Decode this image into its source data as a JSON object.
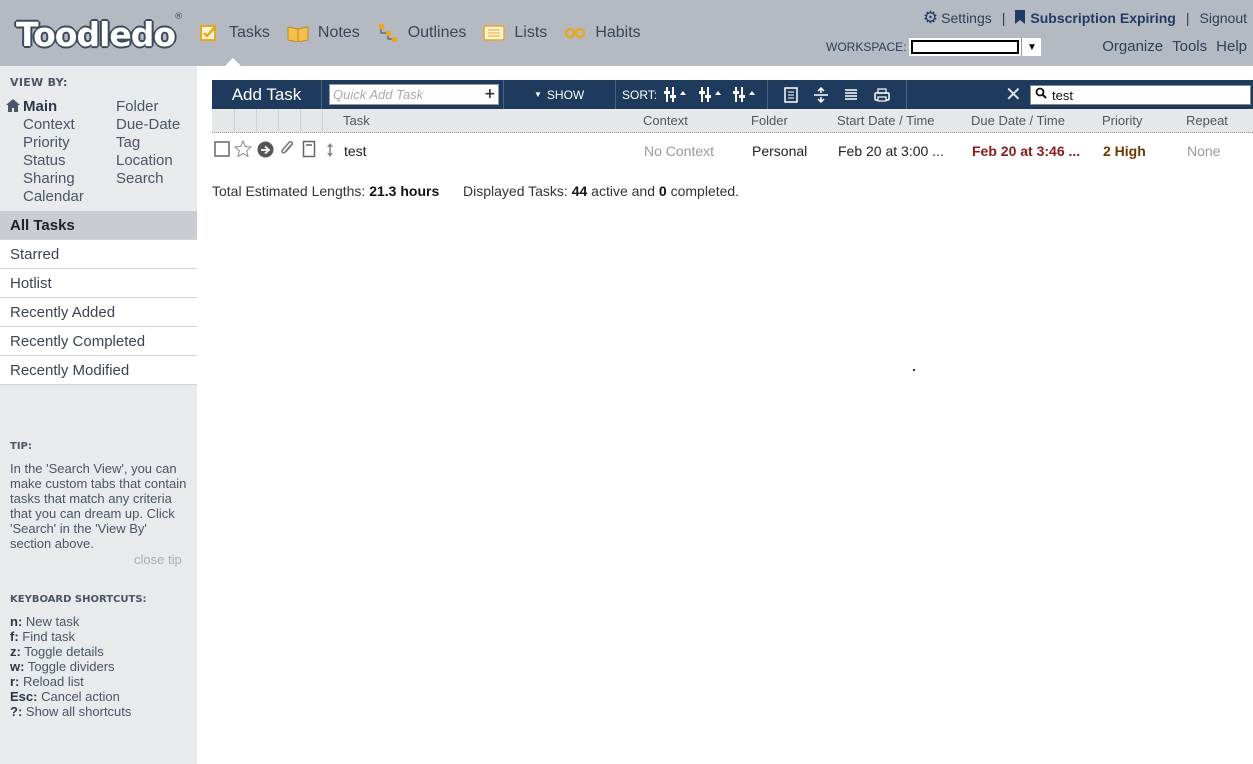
{
  "app": {
    "logo_text": "Toodledo",
    "logo_reg": "®"
  },
  "nav": {
    "items": [
      {
        "label": "Tasks",
        "icon": "tasks-icon"
      },
      {
        "label": "Notes",
        "icon": "notes-icon"
      },
      {
        "label": "Outlines",
        "icon": "outlines-icon"
      },
      {
        "label": "Lists",
        "icon": "lists-icon"
      },
      {
        "label": "Habits",
        "icon": "habits-icon"
      }
    ]
  },
  "topbar": {
    "settings": "Settings",
    "separator": "|",
    "subscription": "Subscription Expiring",
    "signout": "Signout",
    "workspace_label": "WORKSPACE:",
    "workspace_arrow": "▼",
    "organize": "Organize",
    "tools": "Tools",
    "help": "Help"
  },
  "sidebar": {
    "viewby_title": "VIEW BY:",
    "viewby_left": [
      "Main",
      "Context",
      "Priority",
      "Status",
      "Sharing",
      "Calendar"
    ],
    "viewby_right": [
      "Folder",
      "Due-Date",
      "Tag",
      "Location",
      "Search"
    ],
    "lists": [
      "All Tasks",
      "Starred",
      "Hotlist",
      "Recently Added",
      "Recently Completed",
      "Recently Modified"
    ],
    "tip_title": "TIP:",
    "tip_text": "In the 'Search View', you can make custom tabs that contain tasks that match any criteria that you can dream up. Click 'Search' in the 'View By' section above.",
    "close_tip": "close tip",
    "shortcuts_title": "KEYBOARD SHORTCUTS:",
    "shortcuts": [
      {
        "key": "n:",
        "desc": "New task"
      },
      {
        "key": "f:",
        "desc": "Find task"
      },
      {
        "key": "z:",
        "desc": "Toggle details"
      },
      {
        "key": "w:",
        "desc": "Toggle dividers"
      },
      {
        "key": "r:",
        "desc": "Reload list"
      },
      {
        "key": "Esc:",
        "desc": "Cancel action"
      },
      {
        "key": "?:",
        "desc": "Show all shortcuts"
      }
    ]
  },
  "toolbar": {
    "add_task": "Add Task",
    "quick_add_placeholder": "Quick Add Task",
    "quick_add_plus": "+",
    "show": "SHOW",
    "sort": "SORT:",
    "search_value": "test"
  },
  "columns": [
    "Task",
    "Context",
    "Folder",
    "Start Date / Time",
    "Due Date / Time",
    "Priority",
    "Repeat"
  ],
  "tasks": [
    {
      "title": "test",
      "context": "No Context",
      "folder": "Personal",
      "start": "Feb 20 at 3:00 ...",
      "due": "Feb 20 at 3:46 ...",
      "priority": "2 High",
      "repeat": "None"
    }
  ],
  "summary": {
    "lengths_label": "Total Estimated Lengths:",
    "lengths_value": "21.3 hours",
    "displayed_label": "Displayed Tasks:",
    "active_count": "44",
    "active_label": "active and",
    "completed_count": "0",
    "completed_label": "completed."
  },
  "colors": {
    "header_bg": "#b5bac2",
    "toolbar_bg": "#1e3a5c",
    "sidebar_bg": "#e9eaec",
    "due_color": "#8b1a1a",
    "priority_color": "#6b3a00"
  }
}
